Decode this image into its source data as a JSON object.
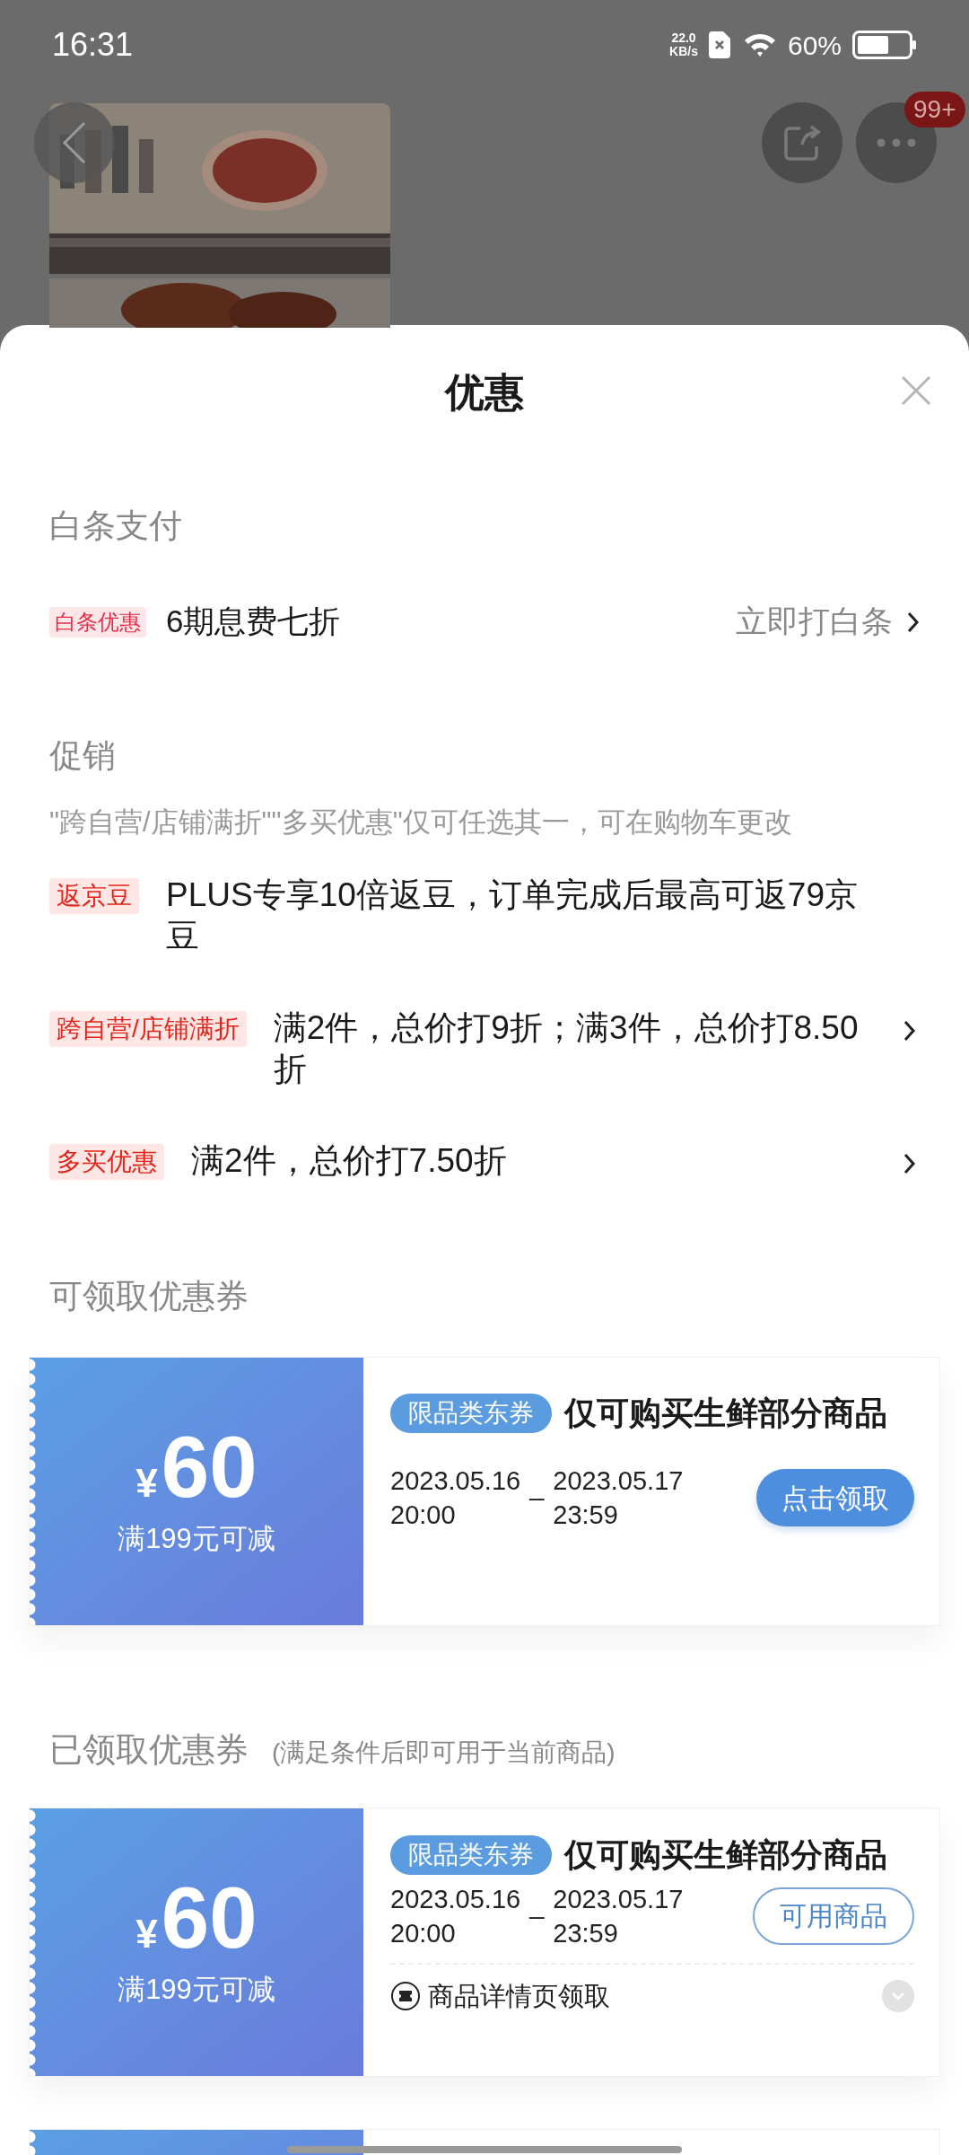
{
  "status_bar": {
    "time": "16:31",
    "net_speed": "22.0",
    "net_unit": "KB/s",
    "battery": "60%"
  },
  "header": {
    "more_badge": "99+"
  },
  "sheet": {
    "title": "优惠"
  },
  "baitiao": {
    "title": "白条支付",
    "rows": [
      {
        "tag": "白条优惠",
        "text": "6期息费七折",
        "action": "立即打白条"
      }
    ]
  },
  "promotions": {
    "title": "促销",
    "note": "\"跨自营/店铺满折\"\"多买优惠\"仅可任选其一，可在购物车更改",
    "rows": [
      {
        "tag": "返京豆",
        "text": "PLUS专享10倍返豆，订单完成后最高可返79京豆",
        "arrow": false
      },
      {
        "tag": "跨自营/店铺满折",
        "text": "满2件，总价打9折；满3件，总价打8.50折",
        "arrow": true
      },
      {
        "tag": "多买优惠",
        "text": "满2件，总价打7.50折",
        "arrow": true
      }
    ]
  },
  "available_coupons": {
    "title": "可领取优惠券",
    "coupons": [
      {
        "currency": "¥",
        "amount": "60",
        "condition": "满199元可减",
        "tag": "限品类东券",
        "desc": "仅可购买生鲜部分商品",
        "start_date": "2023.05.16",
        "start_time": "20:00",
        "separator": "_",
        "end_date": "2023.05.17",
        "end_time": "23:59",
        "button": "点击领取",
        "kind": "claim"
      }
    ]
  },
  "claimed_coupons": {
    "title": "已领取优惠券",
    "note": "(满足条件后即可用于当前商品)",
    "coupons": [
      {
        "currency": "¥",
        "amount": "60",
        "condition": "满199元可减",
        "tag": "限品类东券",
        "desc": "仅可购买生鲜部分商品",
        "start_date": "2023.05.16",
        "start_time": "20:00",
        "separator": "_",
        "end_date": "2023.05.17",
        "end_time": "23:59",
        "button": "可用商品",
        "kind": "claimed",
        "source": "商品详情页领取"
      }
    ]
  }
}
